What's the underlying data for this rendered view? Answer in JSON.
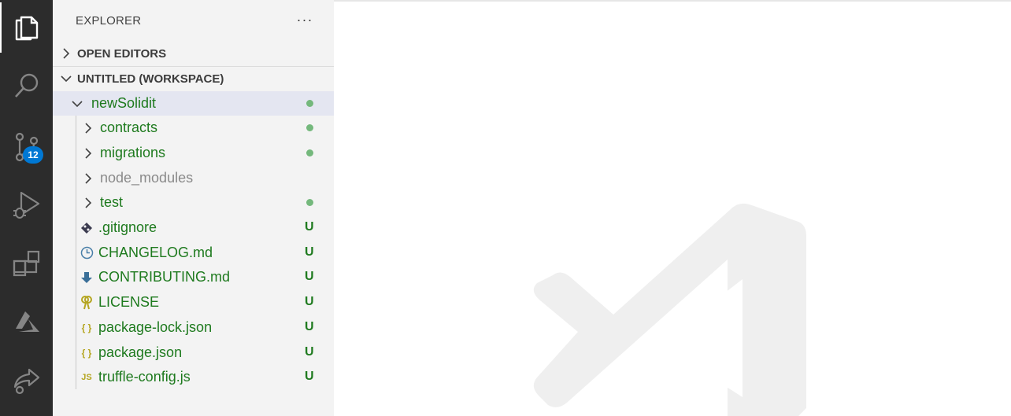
{
  "activity_bar": {
    "items": [
      {
        "icon": "files-icon",
        "active": true
      },
      {
        "icon": "search-icon"
      },
      {
        "icon": "source-control-icon",
        "badge": "12"
      },
      {
        "icon": "run-debug-icon"
      },
      {
        "icon": "extensions-icon"
      },
      {
        "icon": "azure-icon"
      },
      {
        "icon": "live-share-icon"
      }
    ]
  },
  "explorer": {
    "title": "EXPLORER",
    "more": "···",
    "open_editors": "OPEN EDITORS",
    "workspace": "UNTITLED (WORKSPACE)",
    "tree": [
      {
        "label": "newSolidit",
        "kind": "folder-open",
        "status": "dot",
        "color": "#1e7a1e"
      },
      {
        "label": "contracts",
        "kind": "folder",
        "status": "dot",
        "color": "#1e7a1e"
      },
      {
        "label": "migrations",
        "kind": "folder",
        "status": "dot",
        "color": "#1e7a1e"
      },
      {
        "label": "node_modules",
        "kind": "folder",
        "status": "",
        "color": "#8a8a8a"
      },
      {
        "label": "test",
        "kind": "folder",
        "status": "dot",
        "color": "#1e7a1e"
      },
      {
        "label": ".gitignore",
        "kind": "file",
        "icon": "git-icon",
        "status": "U"
      },
      {
        "label": "CHANGELOG.md",
        "kind": "file",
        "icon": "clock-icon",
        "status": "U"
      },
      {
        "label": "CONTRIBUTING.md",
        "kind": "file",
        "icon": "download-arrow-icon",
        "status": "U"
      },
      {
        "label": "LICENSE",
        "kind": "file",
        "icon": "key-icon",
        "status": "U"
      },
      {
        "label": "package-lock.json",
        "kind": "file",
        "icon": "json-icon",
        "status": "U"
      },
      {
        "label": "package.json",
        "kind": "file",
        "icon": "json-icon",
        "status": "U"
      },
      {
        "label": "truffle-config.js",
        "kind": "file",
        "icon": "js-icon",
        "icon_text": "JS",
        "status": "U"
      }
    ]
  },
  "json_icon_text": "{ }",
  "colors": {
    "accent": "#0078d4",
    "untracked": "#1e7a1e",
    "modified_dot": "#74b87c"
  }
}
